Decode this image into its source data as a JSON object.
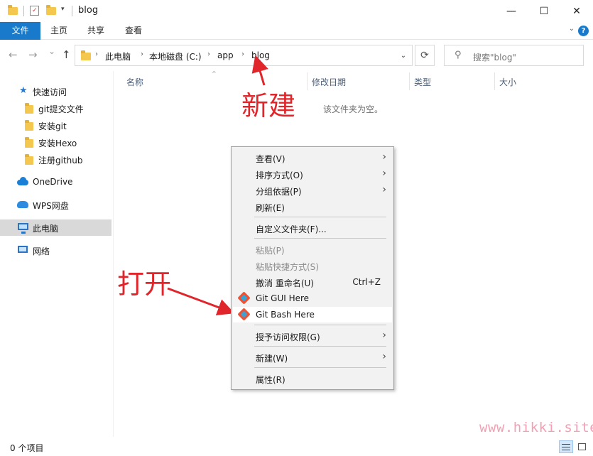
{
  "window": {
    "title": "blog",
    "minimize": "—",
    "maximize": "☐",
    "close": "✕"
  },
  "ribbon": {
    "tabs": [
      "文件",
      "主页",
      "共享",
      "查看"
    ],
    "expand_icon": "chevron-down-icon",
    "help": "?"
  },
  "address": {
    "back": "←",
    "forward": "→",
    "recent": "⌄",
    "up": "↑",
    "crumbs": [
      "此电脑",
      "本地磁盘 (C:)",
      "app",
      "blog"
    ],
    "dropdown": "⌄",
    "refresh": "⟳"
  },
  "search": {
    "placeholder": "搜索\"blog\""
  },
  "sidebar": {
    "quick_access": "快速访问",
    "folders": [
      "git提交文件",
      "安装git",
      "安装Hexo",
      "注册github"
    ],
    "onedrive": "OneDrive",
    "wps": "WPS网盘",
    "this_pc": "此电脑",
    "network": "网络"
  },
  "columns": [
    "名称",
    "修改日期",
    "类型",
    "大小"
  ],
  "empty_message": "该文件夹为空。",
  "annotations": {
    "new": "新建",
    "open": "打开",
    "color": "#e0252b"
  },
  "context_menu": {
    "items": [
      {
        "label": "查看(V)",
        "submenu": true
      },
      {
        "label": "排序方式(O)",
        "submenu": true
      },
      {
        "label": "分组依据(P)",
        "submenu": true
      },
      {
        "label": "刷新(E)"
      },
      {
        "label": "自定义文件夹(F)..."
      },
      {
        "label": "粘贴(P)",
        "disabled": true
      },
      {
        "label": "粘贴快捷方式(S)",
        "disabled": true
      },
      {
        "label": "撤消 重命名(U)",
        "shortcut": "Ctrl+Z"
      },
      {
        "label": "Git GUI Here",
        "icon": "git-icon"
      },
      {
        "label": "Git Bash Here",
        "icon": "git-icon",
        "highlighted": true
      },
      {
        "label": "授予访问权限(G)",
        "submenu": true
      },
      {
        "label": "新建(W)",
        "submenu": true
      },
      {
        "label": "属性(R)"
      }
    ],
    "submenu_glyph": "›"
  },
  "status": {
    "count": "0 个项目"
  },
  "watermark": "www.hikki.site",
  "colors": {
    "accent": "#1979ca",
    "selected": "#d9d9d9"
  }
}
